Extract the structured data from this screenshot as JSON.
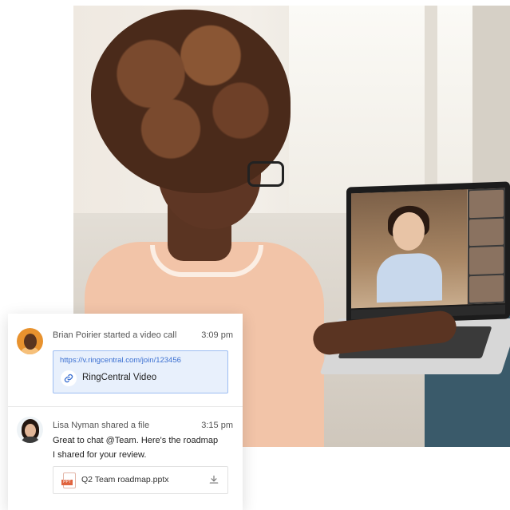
{
  "chat": {
    "messages": [
      {
        "sender_action": "Brian Poirier started a video call",
        "time": "3:09 pm",
        "link_url": "https://v.ringcentral.com/join/123456",
        "link_title": "RingCentral Video"
      },
      {
        "sender_action": "Lisa Nyman shared a file",
        "time": "3:15 pm",
        "text_line1": "Great to chat @Team. Here's the roadmap",
        "text_line2": "I shared for your review.",
        "file_name": "Q2 Team roadmap.pptx",
        "file_tag": "PPT"
      }
    ]
  },
  "icons": {
    "link": "link-icon",
    "download": "download-icon",
    "file": "pptx-file-icon"
  },
  "colors": {
    "link_text": "#3a6fd1",
    "link_box_bg": "#e8f0fc",
    "link_box_border": "#9dbdf2",
    "brian_avatar_bg": "#e8922e",
    "file_tag": "#e0643f"
  }
}
